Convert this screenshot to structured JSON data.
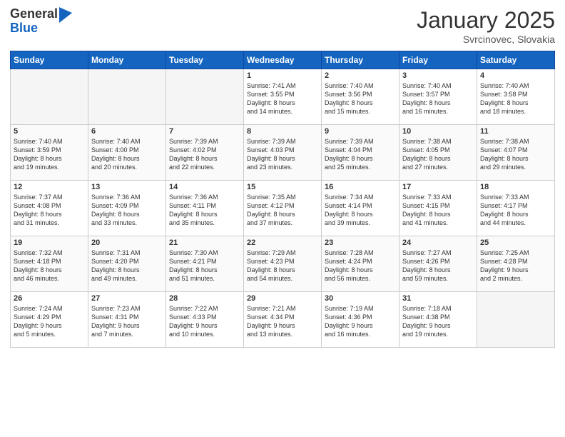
{
  "logo": {
    "general": "General",
    "blue": "Blue"
  },
  "header": {
    "month": "January 2025",
    "location": "Svrcinovec, Slovakia"
  },
  "weekdays": [
    "Sunday",
    "Monday",
    "Tuesday",
    "Wednesday",
    "Thursday",
    "Friday",
    "Saturday"
  ],
  "weeks": [
    [
      {
        "day": "",
        "info": ""
      },
      {
        "day": "",
        "info": ""
      },
      {
        "day": "",
        "info": ""
      },
      {
        "day": "1",
        "info": "Sunrise: 7:41 AM\nSunset: 3:55 PM\nDaylight: 8 hours\nand 14 minutes."
      },
      {
        "day": "2",
        "info": "Sunrise: 7:40 AM\nSunset: 3:56 PM\nDaylight: 8 hours\nand 15 minutes."
      },
      {
        "day": "3",
        "info": "Sunrise: 7:40 AM\nSunset: 3:57 PM\nDaylight: 8 hours\nand 16 minutes."
      },
      {
        "day": "4",
        "info": "Sunrise: 7:40 AM\nSunset: 3:58 PM\nDaylight: 8 hours\nand 18 minutes."
      }
    ],
    [
      {
        "day": "5",
        "info": "Sunrise: 7:40 AM\nSunset: 3:59 PM\nDaylight: 8 hours\nand 19 minutes."
      },
      {
        "day": "6",
        "info": "Sunrise: 7:40 AM\nSunset: 4:00 PM\nDaylight: 8 hours\nand 20 minutes."
      },
      {
        "day": "7",
        "info": "Sunrise: 7:39 AM\nSunset: 4:02 PM\nDaylight: 8 hours\nand 22 minutes."
      },
      {
        "day": "8",
        "info": "Sunrise: 7:39 AM\nSunset: 4:03 PM\nDaylight: 8 hours\nand 23 minutes."
      },
      {
        "day": "9",
        "info": "Sunrise: 7:39 AM\nSunset: 4:04 PM\nDaylight: 8 hours\nand 25 minutes."
      },
      {
        "day": "10",
        "info": "Sunrise: 7:38 AM\nSunset: 4:05 PM\nDaylight: 8 hours\nand 27 minutes."
      },
      {
        "day": "11",
        "info": "Sunrise: 7:38 AM\nSunset: 4:07 PM\nDaylight: 8 hours\nand 29 minutes."
      }
    ],
    [
      {
        "day": "12",
        "info": "Sunrise: 7:37 AM\nSunset: 4:08 PM\nDaylight: 8 hours\nand 31 minutes."
      },
      {
        "day": "13",
        "info": "Sunrise: 7:36 AM\nSunset: 4:09 PM\nDaylight: 8 hours\nand 33 minutes."
      },
      {
        "day": "14",
        "info": "Sunrise: 7:36 AM\nSunset: 4:11 PM\nDaylight: 8 hours\nand 35 minutes."
      },
      {
        "day": "15",
        "info": "Sunrise: 7:35 AM\nSunset: 4:12 PM\nDaylight: 8 hours\nand 37 minutes."
      },
      {
        "day": "16",
        "info": "Sunrise: 7:34 AM\nSunset: 4:14 PM\nDaylight: 8 hours\nand 39 minutes."
      },
      {
        "day": "17",
        "info": "Sunrise: 7:33 AM\nSunset: 4:15 PM\nDaylight: 8 hours\nand 41 minutes."
      },
      {
        "day": "18",
        "info": "Sunrise: 7:33 AM\nSunset: 4:17 PM\nDaylight: 8 hours\nand 44 minutes."
      }
    ],
    [
      {
        "day": "19",
        "info": "Sunrise: 7:32 AM\nSunset: 4:18 PM\nDaylight: 8 hours\nand 46 minutes."
      },
      {
        "day": "20",
        "info": "Sunrise: 7:31 AM\nSunset: 4:20 PM\nDaylight: 8 hours\nand 49 minutes."
      },
      {
        "day": "21",
        "info": "Sunrise: 7:30 AM\nSunset: 4:21 PM\nDaylight: 8 hours\nand 51 minutes."
      },
      {
        "day": "22",
        "info": "Sunrise: 7:29 AM\nSunset: 4:23 PM\nDaylight: 8 hours\nand 54 minutes."
      },
      {
        "day": "23",
        "info": "Sunrise: 7:28 AM\nSunset: 4:24 PM\nDaylight: 8 hours\nand 56 minutes."
      },
      {
        "day": "24",
        "info": "Sunrise: 7:27 AM\nSunset: 4:26 PM\nDaylight: 8 hours\nand 59 minutes."
      },
      {
        "day": "25",
        "info": "Sunrise: 7:25 AM\nSunset: 4:28 PM\nDaylight: 9 hours\nand 2 minutes."
      }
    ],
    [
      {
        "day": "26",
        "info": "Sunrise: 7:24 AM\nSunset: 4:29 PM\nDaylight: 9 hours\nand 5 minutes."
      },
      {
        "day": "27",
        "info": "Sunrise: 7:23 AM\nSunset: 4:31 PM\nDaylight: 9 hours\nand 7 minutes."
      },
      {
        "day": "28",
        "info": "Sunrise: 7:22 AM\nSunset: 4:33 PM\nDaylight: 9 hours\nand 10 minutes."
      },
      {
        "day": "29",
        "info": "Sunrise: 7:21 AM\nSunset: 4:34 PM\nDaylight: 9 hours\nand 13 minutes."
      },
      {
        "day": "30",
        "info": "Sunrise: 7:19 AM\nSunset: 4:36 PM\nDaylight: 9 hours\nand 16 minutes."
      },
      {
        "day": "31",
        "info": "Sunrise: 7:18 AM\nSunset: 4:38 PM\nDaylight: 9 hours\nand 19 minutes."
      },
      {
        "day": "",
        "info": ""
      }
    ]
  ]
}
